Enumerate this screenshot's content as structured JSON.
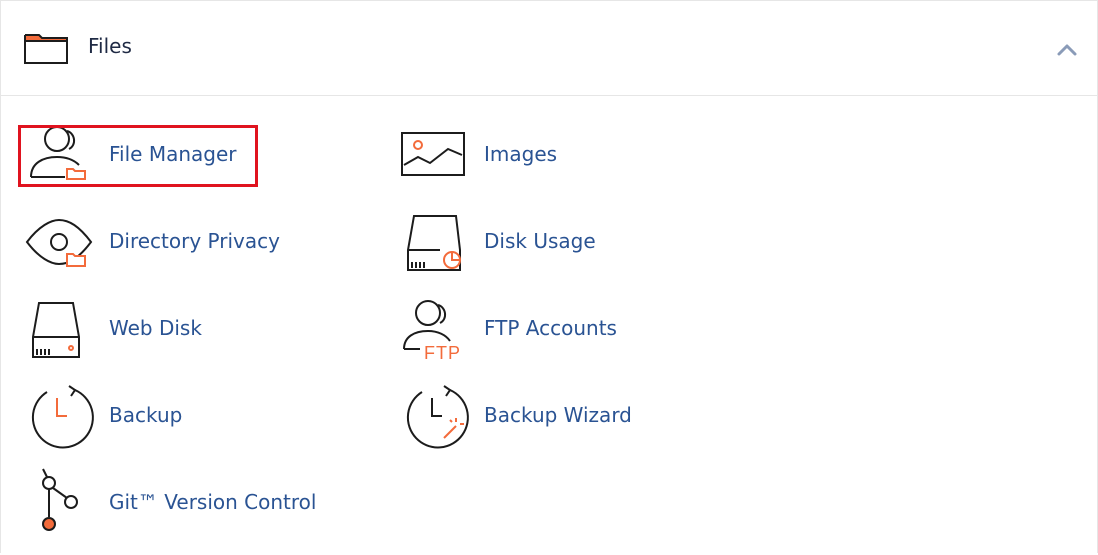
{
  "section": {
    "title": "Files",
    "header_icon": "folder-icon",
    "toggle_icon": "chevron-up-icon",
    "toggle_color": "#8a9bb8"
  },
  "items": [
    {
      "label": "File Manager",
      "icon": "file-manager-icon",
      "highlighted": true
    },
    {
      "label": "Images",
      "icon": "images-icon"
    },
    {
      "label": "Directory Privacy",
      "icon": "directory-privacy-icon"
    },
    {
      "label": "Disk Usage",
      "icon": "disk-usage-icon"
    },
    {
      "label": "Web Disk",
      "icon": "web-disk-icon"
    },
    {
      "label": "FTP Accounts",
      "icon": "ftp-accounts-icon"
    },
    {
      "label": "Backup",
      "icon": "backup-icon"
    },
    {
      "label": "Backup Wizard",
      "icon": "backup-wizard-icon"
    },
    {
      "label": "Git™ Version Control",
      "icon": "git-version-control-icon"
    }
  ],
  "colors": {
    "accent_orange": "#f36b3b",
    "link_blue": "#2a5393",
    "highlight_red": "#e0131f",
    "icon_stroke": "#1c1c1c"
  }
}
